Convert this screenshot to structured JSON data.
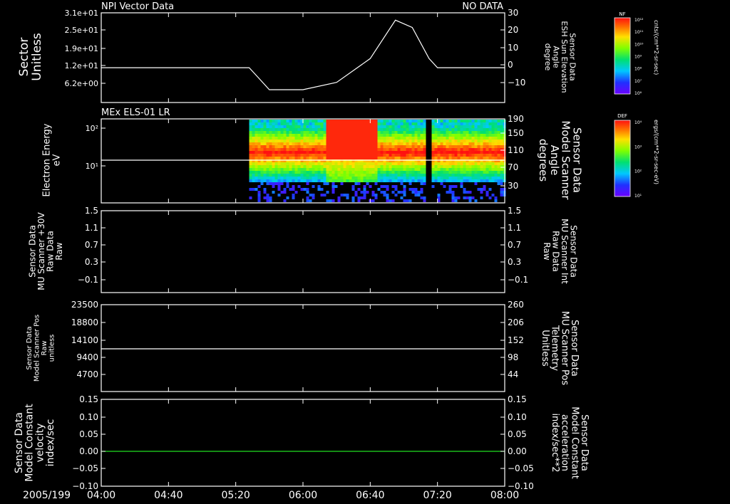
{
  "date_label": "2005/199",
  "time_ticks": [
    "04:00",
    "04:40",
    "05:20",
    "06:00",
    "06:40",
    "07:20",
    "08:00"
  ],
  "colors": {
    "white": "#ffffff",
    "red": "#ff2020",
    "green": "#20e020",
    "bg": "#000000"
  },
  "panels": {
    "p1": {
      "title": "NPI Vector Data",
      "status": "NO DATA",
      "left_label": [
        "Sector",
        "Unitless"
      ],
      "left_ticks": [
        "3.1e+01",
        "2.5e+01",
        "1.9e+01",
        "1.2e+01",
        "6.2e+00"
      ],
      "right_ticks": [
        "30",
        "20",
        "10",
        "0",
        "−10"
      ],
      "right_label": [
        "Sensor Data",
        "ESH Sun Elevation",
        "Angle",
        "degree"
      ]
    },
    "p2": {
      "title": "MEx ELS-01 LR",
      "left_label": [
        "Electron Energy",
        "eV"
      ],
      "left_ticks": [
        "10²",
        "10¹"
      ],
      "right_ticks": [
        "190",
        "150",
        "110",
        "70",
        "30"
      ],
      "right_label": [
        "Sensor Data",
        "Model Scanner",
        "Angle",
        "degrees"
      ]
    },
    "p3": {
      "left_label": [
        "Sensor Data",
        "MU Scanner +30V",
        "Raw Data",
        "Raw"
      ],
      "left_ticks": [
        "1.5",
        "1.1",
        "0.7",
        "0.3",
        "−0.1"
      ],
      "right_ticks": [
        "1.5",
        "1.1",
        "0.7",
        "0.3",
        "−0.1"
      ],
      "right_label": [
        "Sensor Data",
        "MU Scanner Int",
        "Raw Data",
        "Raw"
      ]
    },
    "p4": {
      "left_label": [
        "Sensor Data",
        "Model Scanner Pos",
        "Raw",
        "unitless"
      ],
      "left_ticks": [
        "23500",
        "18800",
        "14100",
        "9400",
        "4700"
      ],
      "right_ticks": [
        "260",
        "206",
        "152",
        "98",
        "44"
      ],
      "right_label": [
        "Sensor Data",
        "MU Scanner Pos",
        "Telemetry",
        "Unitless"
      ]
    },
    "p5": {
      "left_label": [
        "Sensor Data",
        "Model Constant",
        "velocity",
        "index/sec"
      ],
      "left_ticks": [
        "0.15",
        "0.10",
        "0.05",
        "0.00",
        "−0.05",
        "−0.10"
      ],
      "right_ticks": [
        "0.15",
        "0.10",
        "0.05",
        "0.00",
        "−0.05",
        "−0.10"
      ],
      "right_label": [
        "Sensor Data",
        "Model Constant",
        "acceleration",
        "index/sec**2"
      ]
    }
  },
  "colorbars": {
    "nf": {
      "title": "NF",
      "ticks": [
        "10¹²",
        "10¹¹",
        "10¹⁰",
        "10⁹",
        "10⁸",
        "10⁷",
        "10⁶"
      ],
      "units": "cnts/(cm**2-sr-sec)"
    },
    "def": {
      "title": "DEF",
      "ticks": [
        "10⁴",
        "10³",
        "10²",
        "10¹"
      ],
      "units": "ergs/(cm**2-sr-sec-eV)"
    }
  },
  "chart_data": [
    {
      "type": "line",
      "panel": "p1",
      "series": [
        {
          "axis": "right",
          "x_time": [
            "04:00",
            "05:28",
            "05:32",
            "05:40",
            "06:00",
            "06:20",
            "06:40",
            "06:55",
            "07:05",
            "07:15",
            "07:20",
            "08:00"
          ],
          "y": [
            0,
            0,
            -4,
            -12,
            -12,
            -8,
            5,
            26,
            22,
            5,
            0,
            0
          ]
        }
      ],
      "ylim_right": [
        -19,
        30
      ]
    },
    {
      "type": "heatmap",
      "panel": "p2",
      "x_range": [
        "05:28",
        "08:00"
      ],
      "gap": [
        "07:12",
        "07:16"
      ],
      "y": "Electron Energy (eV), log",
      "ylim": [
        1,
        200
      ]
    },
    {
      "type": "line",
      "panel": "p2",
      "series": [
        {
          "axis": "right",
          "y": [
            86,
            86
          ]
        }
      ],
      "ylim_right": [
        0,
        190
      ]
    },
    {
      "type": "line",
      "panel": "p3",
      "series": [],
      "ylim": [
        -0.3,
        1.5
      ]
    },
    {
      "type": "line",
      "panel": "p4",
      "series": [
        {
          "axis": "left",
          "y": [
            11500,
            11500
          ]
        }
      ],
      "ylim": [
        0,
        23500
      ]
    },
    {
      "type": "line",
      "panel": "p5",
      "series": [
        {
          "axis": "left",
          "y": [
            0,
            0
          ]
        }
      ],
      "ylim": [
        -0.1,
        0.15
      ]
    }
  ]
}
